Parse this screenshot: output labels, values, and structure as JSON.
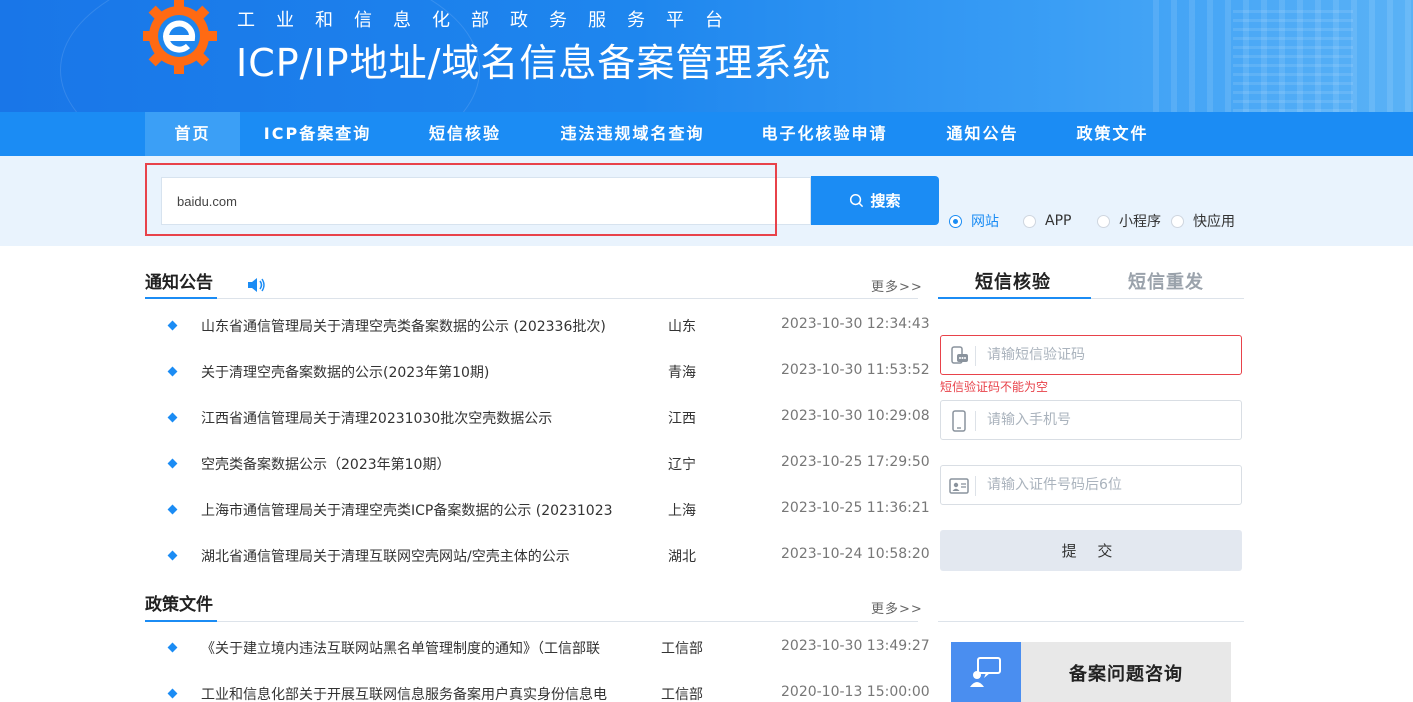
{
  "header": {
    "subtitle": "工业和信息化部政务服务平台",
    "title": "ICP/IP地址/域名信息备案管理系统"
  },
  "nav": {
    "items": [
      "首页",
      "ICP备案查询",
      "短信核验",
      "违法违规域名查询",
      "电子化核验申请",
      "通知公告",
      "政策文件"
    ],
    "active": "首页"
  },
  "search": {
    "value": "baidu.com",
    "button_label": "搜索",
    "options": [
      "网站",
      "APP",
      "小程序",
      "快应用"
    ],
    "selected": "网站"
  },
  "notices": {
    "title": "通知公告",
    "more": "更多>>",
    "rows": [
      {
        "title": "山东省通信管理局关于清理空壳类备案数据的公示 (202336批次)",
        "region": "山东",
        "date": "2023-10-30 12:34:43"
      },
      {
        "title": "关于清理空壳备案数据的公示(2023年第10期)",
        "region": "青海",
        "date": "2023-10-30 11:53:52"
      },
      {
        "title": "江西省通信管理局关于清理20231030批次空壳数据公示",
        "region": "江西",
        "date": "2023-10-30 10:29:08"
      },
      {
        "title": "空壳类备案数据公示（2023年第10期）",
        "region": "辽宁",
        "date": "2023-10-25 17:29:50"
      },
      {
        "title": "上海市通信管理局关于清理空壳类ICP备案数据的公示 (20231023",
        "region": "上海",
        "date": "2023-10-25 11:36:21"
      },
      {
        "title": "湖北省通信管理局关于清理互联网空壳网站/空壳主体的公示",
        "region": "湖北",
        "date": "2023-10-24 10:58:20"
      }
    ]
  },
  "policies": {
    "title": "政策文件",
    "more": "更多>>",
    "rows": [
      {
        "title": "《关于建立境内违法互联网站黑名单管理制度的通知》（工信部联",
        "region": "工信部",
        "date": "2023-10-30 13:49:27"
      },
      {
        "title": "工业和信息化部关于开展互联网信息服务备案用户真实身份信息电",
        "region": "工信部",
        "date": "2020-10-13 15:00:00"
      }
    ]
  },
  "sms": {
    "tab_active": "短信核验",
    "tab_inactive": "短信重发",
    "code_placeholder": "请输短信验证码",
    "code_error": "短信验证码不能为空",
    "phone_placeholder": "请输入手机号",
    "id_placeholder": "请输入证件号码后6位",
    "submit_label": "提 交"
  },
  "consult": {
    "label": "备案问题咨询"
  },
  "colors": {
    "primary": "#1b8cf4",
    "error": "#e8424a"
  }
}
